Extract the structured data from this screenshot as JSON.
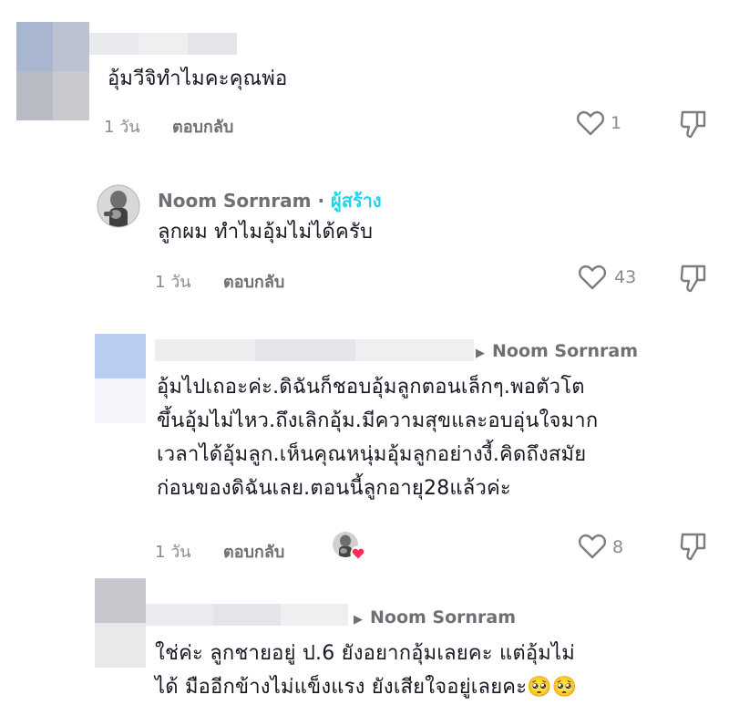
{
  "comments": [
    {
      "text": "อุ้มวีจิทำไมคะคุณพ่อ",
      "time": "1 วัน",
      "reply_label": "ตอบกลับ",
      "likes": "1"
    },
    {
      "author": "Noom Sornram",
      "separator": "·",
      "creator_badge": "ผู้สร้าง",
      "text": "ลูกผม ทำไมอุ้มไม่ได้ครับ",
      "time": "1 วัน",
      "reply_label": "ตอบกลับ",
      "likes": "43"
    },
    {
      "reply_to": "Noom Sornram",
      "lines": [
        "อุ้มไปเถอะค่ะ.ดิฉันก็ชอบอุ้มลูกตอนเล็กๆ.พอตัวโต",
        "ขึ้นอุ้มไม่ไหว.ถึงเลิกอุ้ม.มีความสุขและอบอุ่นใจมาก",
        "เวลาได้อุ้มลูก.เห็นคุณหนุ่มอุ้มลูกอย่างงี้.คิดถึงสมัย",
        "ก่อนของดิฉันเลย.ตอนนี้ลูกอายุ28แล้วค่ะ"
      ],
      "time": "1 วัน",
      "reply_label": "ตอบกลับ",
      "likes": "8"
    },
    {
      "reply_to": "Noom Sornram",
      "lines": [
        "ใช่ค่ะ ลูกชายอยู่ ป.6 ยังอยากอุ้มเลยคะ แต่อุ้มไม่",
        "ได้ มืออีกข้างไม่แข็งแรง ยังเสียใจอยู่เลยคะ🥺🥺"
      ]
    }
  ],
  "colors": {
    "creator_badge": "#20d5ec",
    "liked_heart": "#fe2c55"
  },
  "icons": [
    "heart-icon",
    "dislike-icon",
    "reply-arrow-icon"
  ]
}
